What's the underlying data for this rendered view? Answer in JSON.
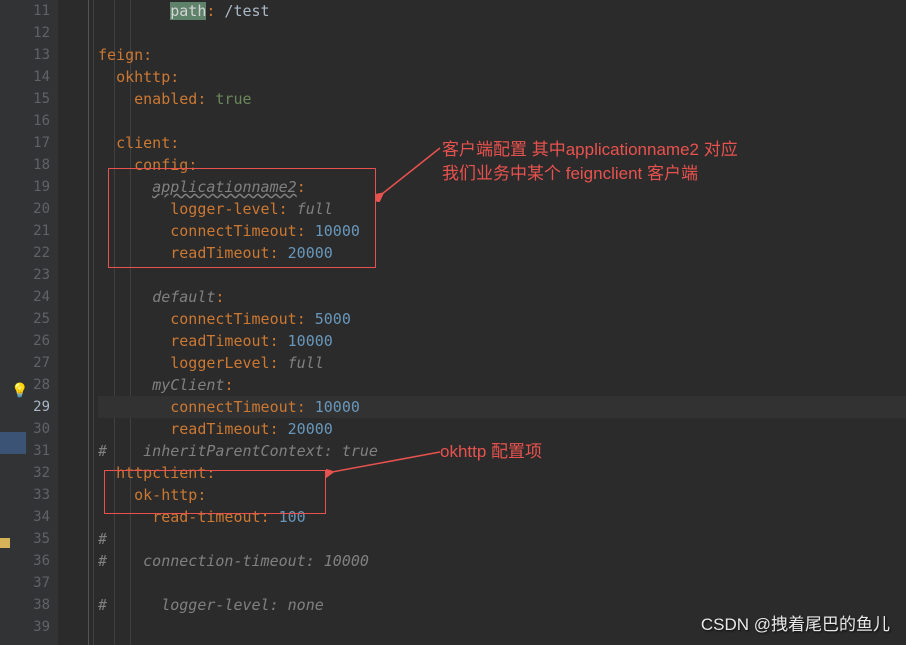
{
  "lineStart": 11,
  "lineEnd": 39,
  "highlightedLine": 29,
  "code": {
    "l11": {
      "indent": "        ",
      "sel": "path",
      "colon": ":",
      "rest": " /test"
    },
    "l13": {
      "k": "feign",
      "colon": ":"
    },
    "l14": {
      "indent": "  ",
      "k": "okhttp",
      "colon": ":"
    },
    "l15": {
      "indent": "    ",
      "k": "enabled",
      "colon": ": ",
      "v": "true"
    },
    "l17": {
      "indent": "  ",
      "k": "client",
      "colon": ":"
    },
    "l18": {
      "indent": "    ",
      "k": "config",
      "colon": ":"
    },
    "l19": {
      "indent": "      ",
      "k": "applicationname2",
      "colon": ":"
    },
    "l20": {
      "indent": "        ",
      "k": "logger-level",
      "colon": ": ",
      "v": "full"
    },
    "l21": {
      "indent": "        ",
      "k": "connectTimeout",
      "colon": ": ",
      "n": "10000"
    },
    "l22": {
      "indent": "        ",
      "k": "readTimeout",
      "colon": ": ",
      "n": "20000"
    },
    "l24": {
      "indent": "      ",
      "k": "default",
      "colon": ":"
    },
    "l25": {
      "indent": "        ",
      "k": "connectTimeout",
      "colon": ": ",
      "n": "5000"
    },
    "l26": {
      "indent": "        ",
      "k": "readTimeout",
      "colon": ": ",
      "n": "10000"
    },
    "l27": {
      "indent": "        ",
      "k": "loggerLevel",
      "colon": ": ",
      "v": "full"
    },
    "l28": {
      "indent": "      ",
      "k": "myClient",
      "colon": ":"
    },
    "l29": {
      "indent": "        ",
      "k": "connectTimeout",
      "colon": ": ",
      "n": "10000"
    },
    "l30": {
      "indent": "        ",
      "k": "readTimeout",
      "colon": ": ",
      "n": "20000"
    },
    "l31": {
      "c": "#    inheritParentContext: true"
    },
    "l32": {
      "indent": "  ",
      "k": "httpclient",
      "colon": ":"
    },
    "l33": {
      "indent": "    ",
      "k": "ok-http",
      "colon": ":"
    },
    "l34": {
      "indent": "      ",
      "k": "read-timeout",
      "colon": ": ",
      "n": "100"
    },
    "l35": {
      "c": "#"
    },
    "l36": {
      "c": "#    connection-timeout: 10000"
    },
    "l38": {
      "c": "#      logger-level: none"
    }
  },
  "annotations": {
    "a1_line1": "客户端配置 其中applicationname2 对应",
    "a1_line2": "我们业务中某个 feignclient 客户端",
    "a2": "okhttp 配置项"
  },
  "watermark": "CSDN @拽着尾巴的鱼儿",
  "markers": {
    "yellow": [
      539,
      540
    ],
    "blue": [
      437
    ]
  }
}
